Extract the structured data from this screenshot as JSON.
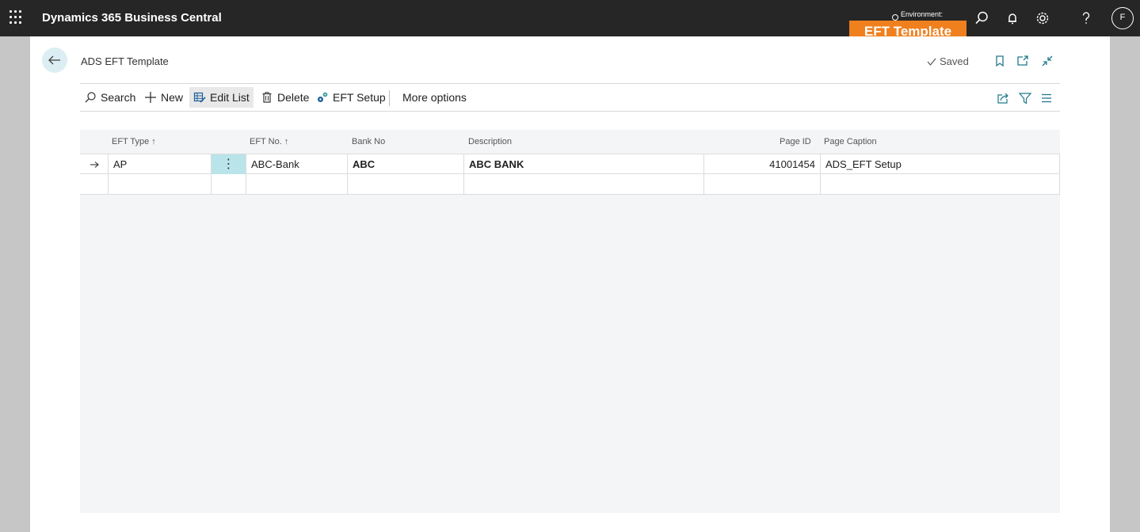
{
  "topbar": {
    "app_name": "Dynamics 365 Business Central",
    "environment_label": "Environment:",
    "badge": "EFT Template",
    "avatar_initial": "F",
    "icons": [
      "search-icon",
      "bell-icon",
      "gear-icon",
      "help-icon"
    ]
  },
  "page": {
    "title": "ADS EFT Template",
    "saved_label": "Saved"
  },
  "actions": {
    "search": "Search",
    "new": "New",
    "edit_list": "Edit List",
    "delete": "Delete",
    "eft_setup": "EFT Setup",
    "more_options": "More options"
  },
  "table": {
    "columns": {
      "eft_type": "EFT Type",
      "eft_no": "EFT No.",
      "bank_no": "Bank No",
      "description": "Description",
      "page_id": "Page ID",
      "page_caption": "Page Caption"
    },
    "sort_arrow": "↑",
    "rows": [
      {
        "eft_type": "AP",
        "dots": "⋮",
        "eft_no": "ABC-Bank",
        "bank_no": "ABC",
        "description": "ABC BANK",
        "page_id": "41001454",
        "page_caption": "ADS_EFT Setup"
      }
    ]
  },
  "colors": {
    "topbar": "#262626",
    "badge": "#f0801e",
    "selected_cell": "#b9e4ea",
    "back_button": "#dceef3"
  }
}
